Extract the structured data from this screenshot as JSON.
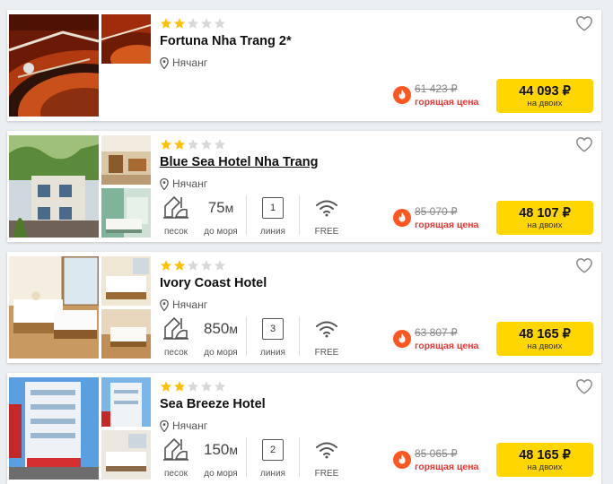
{
  "colors": {
    "accent": "#ffd600",
    "hot": "#e53935",
    "star": "#ffc107",
    "star_empty": "#d8d8d8"
  },
  "hotels": [
    {
      "name": "Fortuna Nha Trang 2*",
      "stars_filled": 2,
      "stars_total": 5,
      "location": "Нячанг",
      "old_price": "61 423 ₽",
      "hot_label": "горящая цена",
      "price": "44 093 ₽",
      "price_note": "на двоих",
      "image_subject": "roulette-wheel"
    },
    {
      "name": "Blue Sea Hotel Nha Trang",
      "stars_filled": 2,
      "stars_total": 5,
      "location": "Нячанг",
      "beach_type": "песок",
      "distance": "75",
      "distance_unit": "м",
      "distance_label": "до моря",
      "line_number": "1",
      "line_label": "линия",
      "wifi_label": "FREE",
      "old_price": "85 070 ₽",
      "hot_label": "горящая цена",
      "price": "48 107 ₽",
      "price_note": "на двоих",
      "image_subject": "hotel-facade"
    },
    {
      "name": "Ivory Coast Hotel",
      "stars_filled": 2,
      "stars_total": 5,
      "location": "Нячанг",
      "beach_type": "песок",
      "distance": "850",
      "distance_unit": "м",
      "distance_label": "до моря",
      "line_number": "3",
      "line_label": "линия",
      "wifi_label": "FREE",
      "old_price": "63 807 ₽",
      "hot_label": "горящая цена",
      "price": "48 165 ₽",
      "price_note": "на двоих",
      "image_subject": "hotel-bedroom"
    },
    {
      "name": "Sea Breeze Hotel",
      "stars_filled": 2,
      "stars_total": 5,
      "location": "Нячанг",
      "beach_type": "песок",
      "distance": "150",
      "distance_unit": "м",
      "distance_label": "до моря",
      "line_number": "2",
      "line_label": "линия",
      "wifi_label": "FREE",
      "old_price": "85 065 ₽",
      "hot_label": "горящая цена",
      "price": "48 165 ₽",
      "price_note": "на двоих",
      "image_subject": "hotel-building"
    }
  ]
}
